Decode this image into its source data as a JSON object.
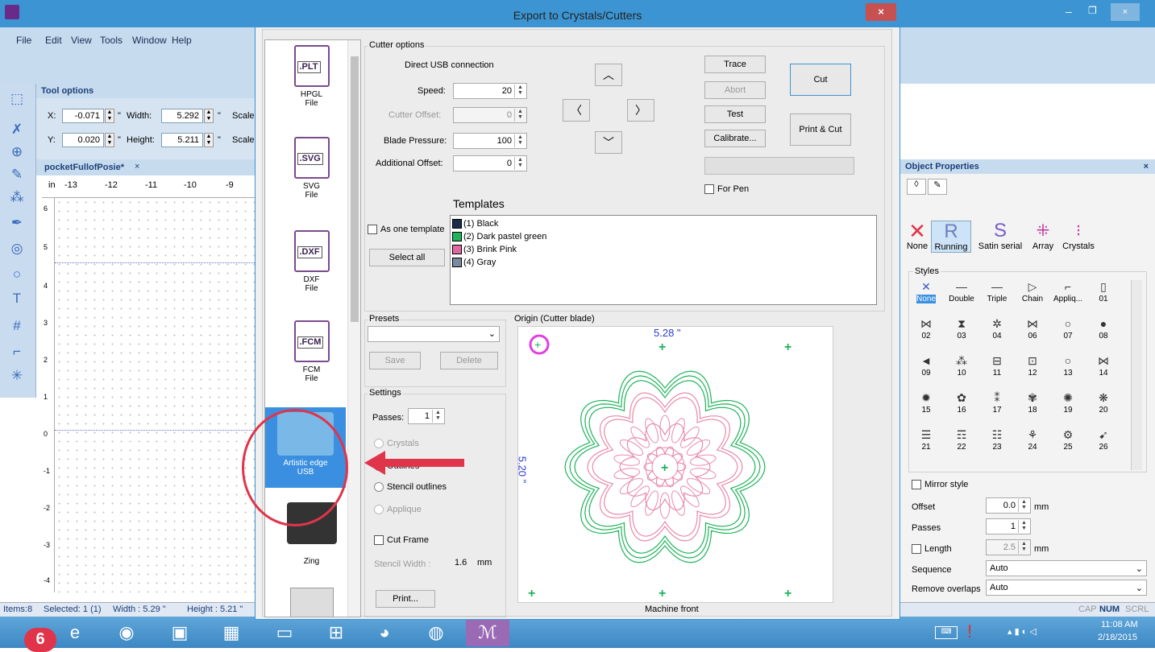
{
  "app": {
    "menu": [
      "File",
      "Edit",
      "View",
      "Tools",
      "Window",
      "Help"
    ]
  },
  "tool_options": {
    "title": "Tool options",
    "x_label": "X:",
    "x_value": "-0.071",
    "width_label": "Width:",
    "width_value": "5.292",
    "unit": "\"",
    "scale_label": "Scale",
    "y_label": "Y:",
    "y_value": "0.020",
    "height_label": "Height:",
    "height_value": "5.211"
  },
  "document_tab": "pocketFullofPosie*",
  "ruler": {
    "unit": "in",
    "h_ticks": [
      "-13",
      "-12",
      "-11",
      "-10",
      "-9"
    ],
    "v_ticks": [
      "6",
      "5",
      "4",
      "3",
      "2",
      "1",
      "0",
      "-1",
      "-2",
      "-3",
      "-4"
    ]
  },
  "status": {
    "items": "Items:8",
    "selected": "Selected: 1 (1)",
    "width": "Width : 5.29 \"",
    "height": "Height : 5.21 \"",
    "cap": "CAP",
    "num": "NUM",
    "scrl": "SCRL"
  },
  "taskbar": {
    "time": "11:08 AM",
    "date": "2/18/2015",
    "badge": "6"
  },
  "dialog": {
    "title": "Export to Crystals/Cutters",
    "close": "×",
    "devices": [
      {
        "icon": ".PLT",
        "name": "HPGL\nFile"
      },
      {
        "icon": ".SVG",
        "name": "SVG\nFile"
      },
      {
        "icon": ".DXF",
        "name": "DXF\nFile"
      },
      {
        "icon": ".FCM",
        "name": "FCM\nFile"
      },
      {
        "name": "Artistic edge\nUSB"
      },
      {
        "name": "Zing"
      }
    ],
    "cutter_options": {
      "label": "Cutter options",
      "connection": "Direct USB connection",
      "speed_label": "Speed:",
      "speed": "20",
      "cutter_offset_label": "Cutter Offset:",
      "cutter_offset": "0",
      "blade_label": "Blade Pressure:",
      "blade": "100",
      "additional_label": "Additional Offset:",
      "additional": "0",
      "trace": "Trace",
      "abort": "Abort",
      "test": "Test",
      "calibrate": "Calibrate...",
      "cut": "Cut",
      "print_cut": "Print & Cut",
      "for_pen": "For Pen"
    },
    "templates": {
      "label": "Templates",
      "as_one": "As one template",
      "select_all": "Select all",
      "items": [
        {
          "name": "(1) Black",
          "color": "#1c2a4a"
        },
        {
          "name": "(2) Dark pastel green",
          "color": "#1fb35a"
        },
        {
          "name": "(3) Brink Pink",
          "color": "#e06aa0"
        },
        {
          "name": "(4) Gray",
          "color": "#7a8aa0"
        }
      ]
    },
    "presets": {
      "label": "Presets",
      "save": "Save",
      "delete": "Delete"
    },
    "settings": {
      "label": "Settings",
      "passes_label": "Passes:",
      "passes": "1",
      "crystals": "Crystals",
      "outlines": "Outlines",
      "stencil": "Stencil outlines",
      "applique": "Applique",
      "cut_frame": "Cut Frame",
      "stencil_width_label": "Stencil Width :",
      "stencil_width": "1.6",
      "mm": "mm",
      "print": "Print..."
    },
    "origin": {
      "label": "Origin (Cutter blade)",
      "width": "5.28 \"",
      "height": "5.20 \"",
      "front": "Machine front"
    }
  },
  "object_properties": {
    "title": "Object Properties",
    "types": [
      "None",
      "Running",
      "Satin serial",
      "Array",
      "Crystals"
    ],
    "styles_label": "Styles",
    "styles": [
      [
        "None",
        "Double",
        "Triple",
        "Chain",
        "Appliq...",
        "01"
      ],
      [
        "02",
        "03",
        "04",
        "06",
        "07",
        "08"
      ],
      [
        "09",
        "10",
        "11",
        "12",
        "13",
        "14"
      ],
      [
        "15",
        "16",
        "17",
        "18",
        "19",
        "20"
      ],
      [
        "21",
        "22",
        "23",
        "24",
        "25",
        "26"
      ]
    ],
    "mirror": "Mirror style",
    "offset_label": "Offset",
    "offset": "0.0",
    "mm": "mm",
    "passes_label": "Passes",
    "passes": "1",
    "length_label": "Length",
    "length": "2.5",
    "sequence_label": "Sequence",
    "sequence": "Auto",
    "overlaps_label": "Remove overlaps",
    "overlaps": "Auto"
  },
  "colors": {
    "accent": "#3c95d2",
    "annotation": "#e0344a",
    "green": "#1fb35a",
    "pink": "#e88aa8"
  }
}
